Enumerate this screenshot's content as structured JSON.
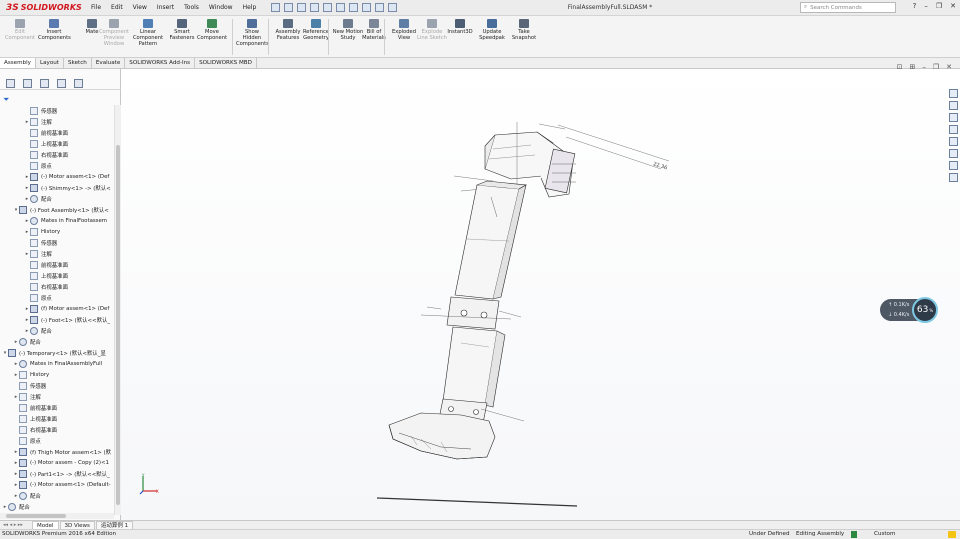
{
  "app": {
    "logo_text": "SOLIDWORKS",
    "doc_title": "FinalAssemblyFull.SLDASM *"
  },
  "menu": [
    "File",
    "Edit",
    "View",
    "Insert",
    "Tools",
    "Window",
    "Help"
  ],
  "search": {
    "placeholder": "Search Commands"
  },
  "command_manager": [
    {
      "label": "Edit Component",
      "enabled": false,
      "color": "#9aa3ae"
    },
    {
      "label": "Insert Components",
      "enabled": true,
      "color": "#5a7bb0"
    },
    {
      "label": "Mate",
      "enabled": true,
      "color": "#5f6f86"
    },
    {
      "label": "Component Preview Window",
      "enabled": false,
      "color": "#9aa3ae"
    },
    {
      "label": "Linear Component Pattern",
      "enabled": true,
      "color": "#4f7fb5"
    },
    {
      "label": "Smart Fasteners",
      "enabled": true,
      "color": "#55657c"
    },
    {
      "label": "Move Component",
      "enabled": true,
      "color": "#3f8a56"
    },
    {
      "label": "Show Hidden Components",
      "enabled": true,
      "color": "#4f6f9a"
    },
    {
      "label": "Assembly Features",
      "enabled": true,
      "color": "#5b6b82"
    },
    {
      "label": "Reference Geometry",
      "enabled": true,
      "color": "#4a7fa8"
    },
    {
      "label": "New Motion Study",
      "enabled": true,
      "color": "#6d7b8f"
    },
    {
      "label": "Bill of Materials",
      "enabled": true,
      "color": "#7b8698"
    },
    {
      "label": "Exploded View",
      "enabled": true,
      "color": "#5f7ea6"
    },
    {
      "label": "Explode Line Sketch",
      "enabled": false,
      "color": "#9aa3ae"
    },
    {
      "label": "Instant3D",
      "enabled": true,
      "color": "#4c5d74"
    },
    {
      "label": "Update Speedpak",
      "enabled": true,
      "color": "#4a6e9b"
    },
    {
      "label": "Take Snapshot",
      "enabled": true,
      "color": "#5b6678"
    }
  ],
  "tabs": [
    "Assembly",
    "Layout",
    "Sketch",
    "Evaluate",
    "SOLIDWORKS Add-Ins",
    "SOLIDWORKS MBD"
  ],
  "active_tab": "Assembly",
  "tree": [
    {
      "indent": 2,
      "arrow": "",
      "icon": "sensor",
      "label": "传感器"
    },
    {
      "indent": 2,
      "arrow": "▸",
      "icon": "annotation",
      "label": "注解"
    },
    {
      "indent": 2,
      "arrow": "",
      "icon": "plane",
      "label": "前视基准面"
    },
    {
      "indent": 2,
      "arrow": "",
      "icon": "plane",
      "label": "上视基准面"
    },
    {
      "indent": 2,
      "arrow": "",
      "icon": "plane",
      "label": "右视基准面"
    },
    {
      "indent": 2,
      "arrow": "",
      "icon": "origin",
      "label": "原点"
    },
    {
      "indent": 2,
      "arrow": "▸",
      "icon": "asm",
      "label": "(-) Motor assem<1> (Def"
    },
    {
      "indent": 2,
      "arrow": "▸",
      "icon": "asm",
      "label": "(-) Shimmy<1> -> (默认<"
    },
    {
      "indent": 2,
      "arrow": "▸",
      "icon": "mate",
      "label": "配合"
    },
    {
      "indent": 1,
      "arrow": "▾",
      "icon": "asm",
      "label": "(-) Foot Assembly<1> (默认<"
    },
    {
      "indent": 2,
      "arrow": "▸",
      "icon": "mate",
      "label": "Mates in FinalFootassem"
    },
    {
      "indent": 2,
      "arrow": "▸",
      "icon": "history",
      "label": "History"
    },
    {
      "indent": 2,
      "arrow": "",
      "icon": "sensor",
      "label": "传感器"
    },
    {
      "indent": 2,
      "arrow": "▸",
      "icon": "annotation",
      "label": "注解"
    },
    {
      "indent": 2,
      "arrow": "",
      "icon": "plane",
      "label": "前视基准面"
    },
    {
      "indent": 2,
      "arrow": "",
      "icon": "plane",
      "label": "上视基准面"
    },
    {
      "indent": 2,
      "arrow": "",
      "icon": "plane",
      "label": "右视基准面"
    },
    {
      "indent": 2,
      "arrow": "",
      "icon": "origin",
      "label": "原点"
    },
    {
      "indent": 2,
      "arrow": "▸",
      "icon": "asm",
      "label": "(f) Motor assem<1> (Def"
    },
    {
      "indent": 2,
      "arrow": "▸",
      "icon": "asm",
      "label": "(-) Foot<1> (默认<<默认_"
    },
    {
      "indent": 2,
      "arrow": "▸",
      "icon": "mate",
      "label": "配合"
    },
    {
      "indent": 1,
      "arrow": "▸",
      "icon": "mate",
      "label": "配合"
    },
    {
      "indent": 0,
      "arrow": "▾",
      "icon": "asm",
      "label": "(-) Temporary<1> (默认<默认_显"
    },
    {
      "indent": 1,
      "arrow": "▸",
      "icon": "mate",
      "label": "Mates in FinalAssemblyFull"
    },
    {
      "indent": 1,
      "arrow": "▸",
      "icon": "history",
      "label": "History"
    },
    {
      "indent": 1,
      "arrow": "",
      "icon": "sensor",
      "label": "传感器"
    },
    {
      "indent": 1,
      "arrow": "▸",
      "icon": "annotation",
      "label": "注解"
    },
    {
      "indent": 1,
      "arrow": "",
      "icon": "plane",
      "label": "前视基准面"
    },
    {
      "indent": 1,
      "arrow": "",
      "icon": "plane",
      "label": "上视基准面"
    },
    {
      "indent": 1,
      "arrow": "",
      "icon": "plane",
      "label": "右视基准面"
    },
    {
      "indent": 1,
      "arrow": "",
      "icon": "origin",
      "label": "原点"
    },
    {
      "indent": 1,
      "arrow": "▸",
      "icon": "asm",
      "label": "(f) Thigh Motor assem<1> (默"
    },
    {
      "indent": 1,
      "arrow": "▸",
      "icon": "asm",
      "label": "(-) Motor assem - Copy (2)<1"
    },
    {
      "indent": 1,
      "arrow": "▸",
      "icon": "asm",
      "label": "(-) Part1<1> -> (默认<<默认_"
    },
    {
      "indent": 1,
      "arrow": "▸",
      "icon": "asm",
      "label": "(-) Motor assem<1> (Default-"
    },
    {
      "indent": 1,
      "arrow": "▸",
      "icon": "mate",
      "label": "配合"
    },
    {
      "indent": 0,
      "arrow": "▸",
      "icon": "mate",
      "label": "配合"
    }
  ],
  "speedometer": {
    "value": "63",
    "unit": "%",
    "up": "0.1K/s",
    "down": "0.4K/s"
  },
  "bottom_tabs": [
    "Model",
    "3D Views",
    "运动算例 1"
  ],
  "active_bottom_tab": "Model",
  "status": {
    "left": "SOLIDWORKS Premium 2016 x64 Edition",
    "s1": "Under Defined",
    "s2": "Editing Assembly",
    "s3": "Custom"
  },
  "colors": {
    "brand": "#d2191f",
    "accent": "#2a6ad0"
  }
}
